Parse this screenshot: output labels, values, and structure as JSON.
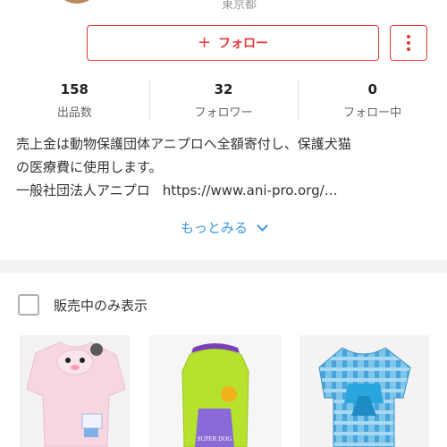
{
  "header": {
    "location_text": "東京都"
  },
  "actions": {
    "follow_label": "フォロー",
    "follow_icon": "plus-icon",
    "more_icon": "more-vertical-icon",
    "accent_color": "#e53935"
  },
  "stats": [
    {
      "value": "158",
      "label": "出品数"
    },
    {
      "value": "32",
      "label": "フォロワー"
    },
    {
      "value": "0",
      "label": "フォロー中"
    }
  ],
  "bio": {
    "line1": "売上金は動物保護団体アニプロへ全額寄付し、保護犬猫",
    "line2": "の医療費に使用します。",
    "line3_org": "一般社団法人アニプロ",
    "line3_link": "https://www.ani-pro.org/…"
  },
  "more": {
    "label": "もっとみる",
    "icon": "chevron-down-icon",
    "color": "#3b9ae1"
  },
  "filter": {
    "label": "販売中のみ表示",
    "checked": false
  },
  "products": [
    {
      "name": "pink-dog-shirt"
    },
    {
      "name": "green-super-dog-shirt",
      "print_text": "SUPER DOG"
    },
    {
      "name": "blue-check-dog-shirt"
    }
  ]
}
